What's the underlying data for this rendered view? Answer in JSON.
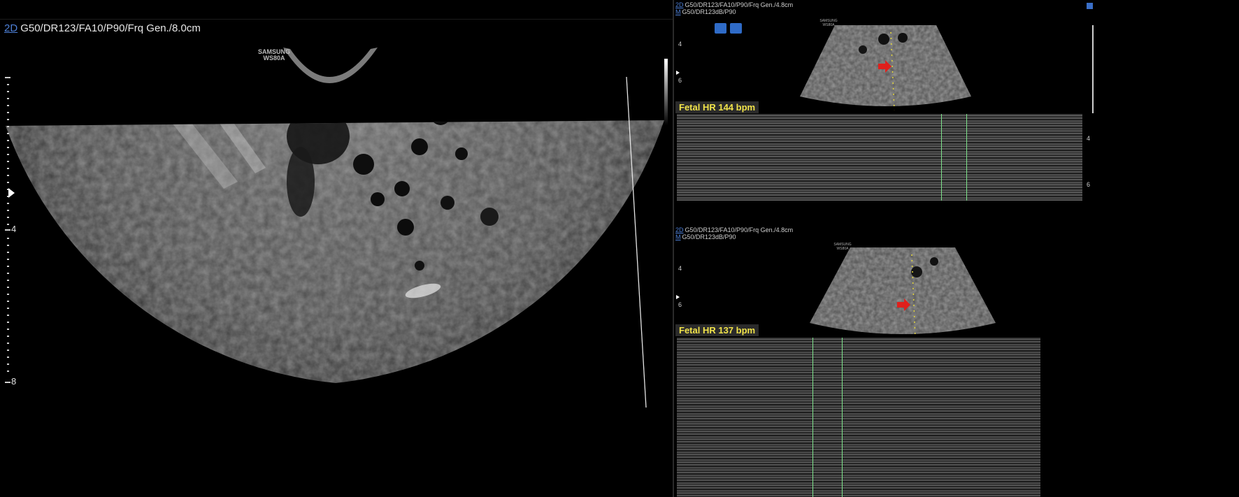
{
  "main_view": {
    "mode": "2D",
    "params": "G50/DR123/FA10/P90/Frq Gen./8.0cm",
    "brand_line1": "SAMSUNG",
    "brand_line2": "WS80A",
    "depth_ticks": [
      "4",
      "8"
    ],
    "tool_icons": [
      "camera-icon",
      "dual-view-icon"
    ]
  },
  "panel_top": {
    "line1_mode": "2D",
    "line1_params": "G50/DR123/FA10/P90/Frq Gen./4.8cm",
    "line2_mode": "M",
    "line2_params": "G50/DR123dB/P90",
    "brand_line1": "SAMSUNG",
    "brand_line2": "WS80A",
    "depth_ticks": [
      "4",
      "6"
    ],
    "mmode_ticks": [
      "4",
      "6"
    ],
    "fetal_hr": "Fetal HR 144 bpm",
    "marker_color": "#e0201c"
  },
  "panel_bottom": {
    "line1_mode": "2D",
    "line1_params": "G50/DR123/FA10/P90/Frq Gen./4.8cm",
    "line2_mode": "M",
    "line2_params": "G50/DR123dB/P90",
    "brand_line1": "SAMSUNG",
    "brand_line2": "WS80A",
    "depth_ticks": [
      "4",
      "6"
    ],
    "fetal_hr": "Fetal HR 137 bpm",
    "marker_color": "#e0201c"
  }
}
